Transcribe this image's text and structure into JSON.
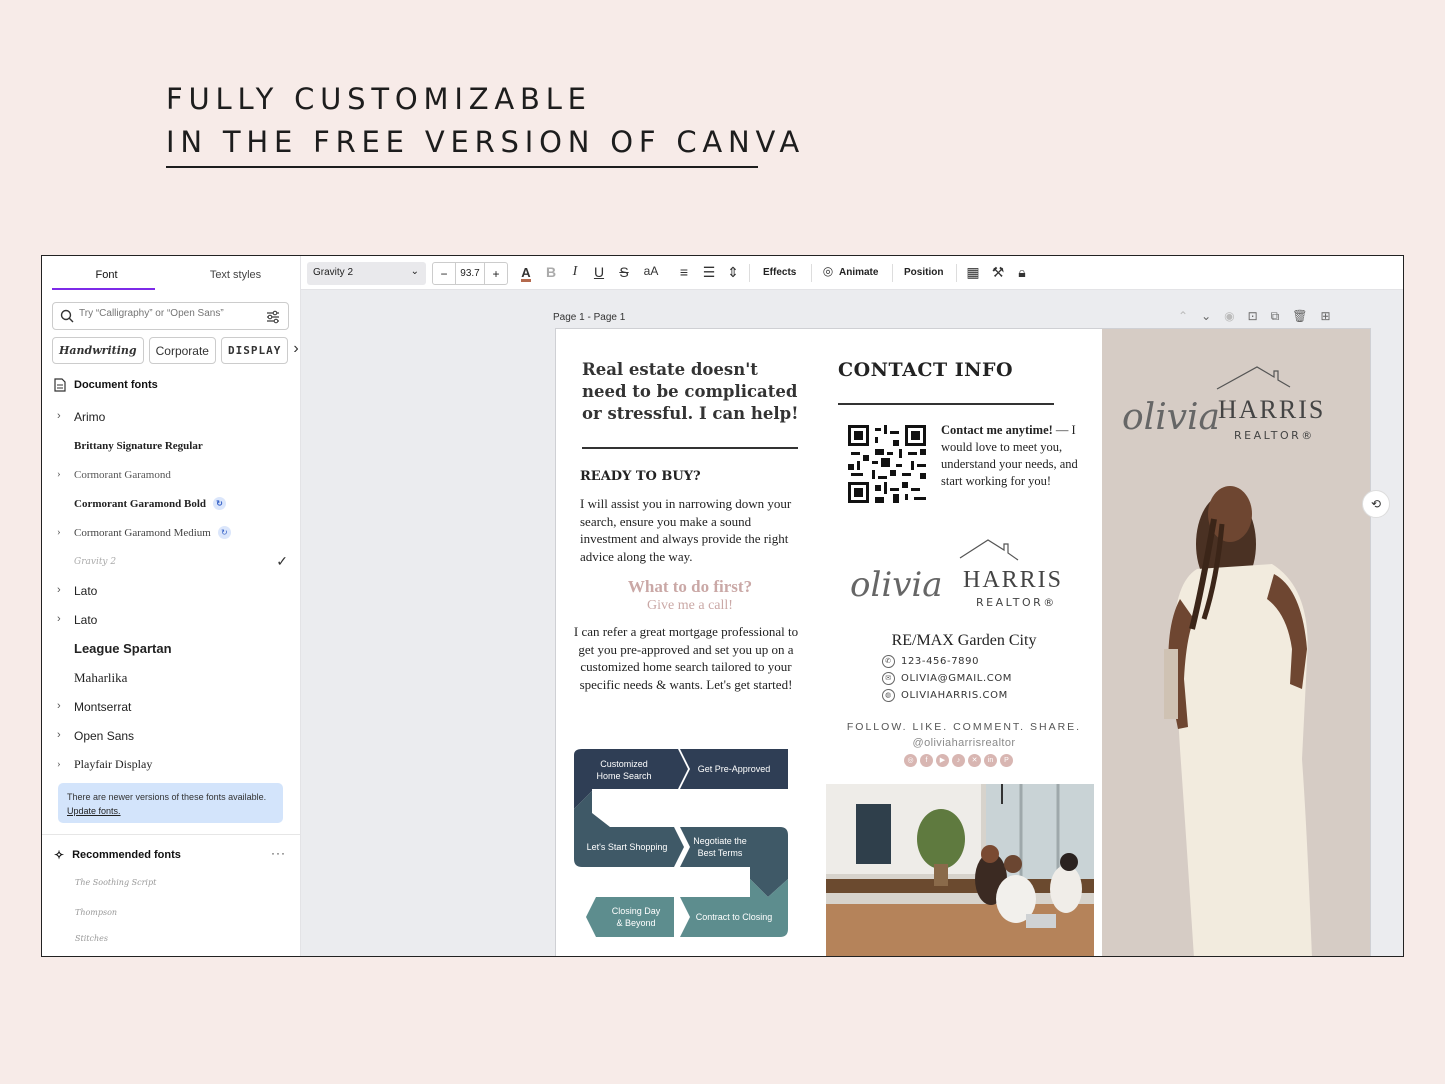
{
  "headline": {
    "line1": "FULLY CUSTOMIZABLE",
    "line2": "IN THE FREE VERSION OF CANVA"
  },
  "panel": {
    "tabs": [
      "Font",
      "Text styles"
    ],
    "search_placeholder": "Try “Calligraphy” or “Open Sans”",
    "chips": [
      "Handwriting",
      "Corporate",
      "DISPLAY"
    ],
    "document_fonts_heading": "Document fonts",
    "fonts": [
      {
        "name": "Arimo",
        "expandable": true
      },
      {
        "name": "Brittany Signature Regular",
        "expandable": false
      },
      {
        "name": "Cormorant Garamond",
        "expandable": true
      },
      {
        "name": "Cormorant Garamond Bold",
        "expandable": false,
        "sync": true
      },
      {
        "name": "Cormorant Garamond Medium",
        "expandable": true,
        "sync": true
      },
      {
        "name": "Gravity 2",
        "expandable": false,
        "selected": true
      },
      {
        "name": "Lato",
        "expandable": true
      },
      {
        "name": "Lato",
        "expandable": true
      },
      {
        "name": "League Spartan",
        "expandable": false
      },
      {
        "name": "Maharlika",
        "expandable": false
      },
      {
        "name": "Montserrat",
        "expandable": true
      },
      {
        "name": "Open Sans",
        "expandable": true
      },
      {
        "name": "Playfair Display",
        "expandable": true
      }
    ],
    "notice_text": "There are newer versions of these fonts available.",
    "notice_link": "Update fonts.",
    "recommended_heading": "Recommended fonts",
    "recommended": [
      "The Soothing Script",
      "Thompson",
      "Stitches"
    ]
  },
  "toolbar": {
    "font_family": "Gravity 2",
    "font_size": "93.7",
    "minus": "−",
    "plus": "+",
    "case_label": "aA",
    "effects": "Effects",
    "animate": "Animate",
    "position": "Position"
  },
  "canvas": {
    "page_label": "Page 1 - Page 1"
  },
  "brochure": {
    "intro": "Real estate doesn't need to be complicated or stressful.  I can help!",
    "ready_heading": "READY TO BUY?",
    "ready_body": "I will assist you in narrowing down your search, ensure you make a sound investment and always provide the right advice along the way.",
    "what_first": "What to do first?",
    "give_call": "Give me a call!",
    "refer_body": "I can refer a great mortgage professional to get you pre-approved and set you up on a customized home search tailored to your specific needs & wants. Let's get started!",
    "steps": [
      "Customized Home Search",
      "Get Pre-Approved",
      "Let's Start Shopping",
      "Negotiate the Best Terms",
      "Closing Day & Beyond",
      "Contract to Closing"
    ],
    "contact_heading": "CONTACT INFO",
    "contact_lead": "Contact me anytime!",
    "contact_body": "— I would love to meet you, understand your needs, and start working for you!",
    "logo_script": "olivia",
    "logo_name": "HARRIS",
    "logo_sub": "REALTOR®",
    "brokerage": "RE/MAX Garden City",
    "phone": "123-456-7890",
    "email": "OLIVIA@GMAIL.COM",
    "website": "OLIVIAHARRIS.COM",
    "follow": "FOLLOW. LIKE. COMMENT. SHARE.",
    "handle": "@oliviaharrisrealtor",
    "colors": {
      "navy": "#2f3e55",
      "slate": "#3f5967",
      "teal": "#5d8d8e",
      "blush": "#caa8a6",
      "accent_purple": "#7d2ae8"
    }
  }
}
